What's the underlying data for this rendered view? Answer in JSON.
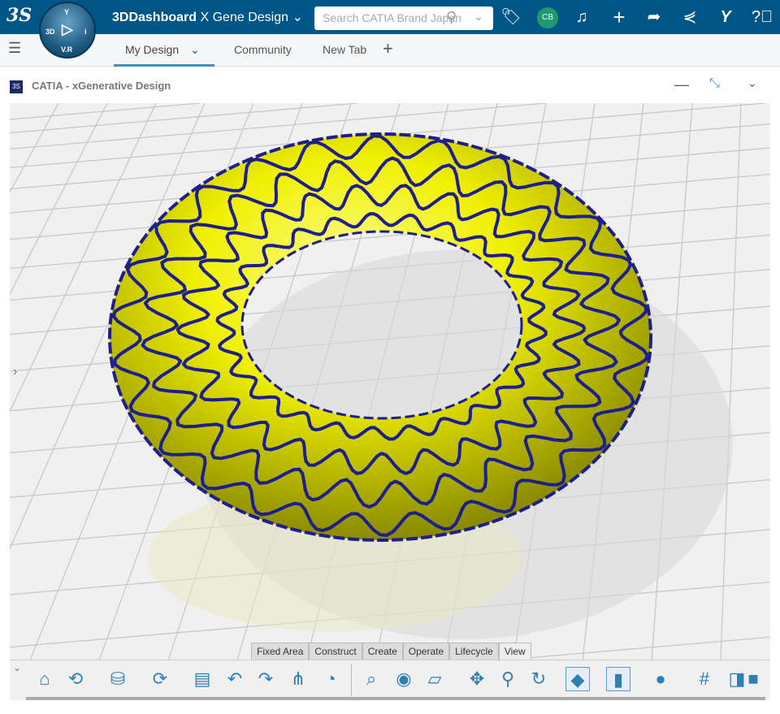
{
  "topbar": {
    "brand": "3DDashboard",
    "dashboard": "X Gene Design",
    "search_placeholder": "Search CATIA Brand Japan",
    "avatar": "CB",
    "compass": {
      "top": "Y",
      "left": "3D",
      "right": "i",
      "bottom": "V.R"
    },
    "accent": "#005686"
  },
  "tabs": [
    {
      "label": "My Design",
      "active": true
    },
    {
      "label": "Community"
    },
    {
      "label": "New Tab"
    }
  ],
  "widget": {
    "title": "CATIA - xGenerative Design"
  },
  "toolbar": {
    "tabs": [
      "Fixed Area",
      "Construct",
      "Create",
      "Operate",
      "Lifecycle",
      "View"
    ],
    "selected_tab": "View",
    "icons": [
      "home-icon",
      "rotate-icon",
      "database-icon",
      "sync-check-icon",
      "compare-icon",
      "undo-icon",
      "redo-icon",
      "graph-icon",
      "feed-icon",
      "zoom-fit-icon",
      "hide-show-icon",
      "view-cube-icon",
      "pan-icon",
      "zoom-icon",
      "rotate-view-icon",
      "shading-icon",
      "material-icon",
      "ambient-icon",
      "grid-icon",
      "section-icon",
      "box-icon"
    ]
  },
  "model": {
    "surface_color": "#f0f000",
    "lattice_color": "#1e1e8c"
  }
}
